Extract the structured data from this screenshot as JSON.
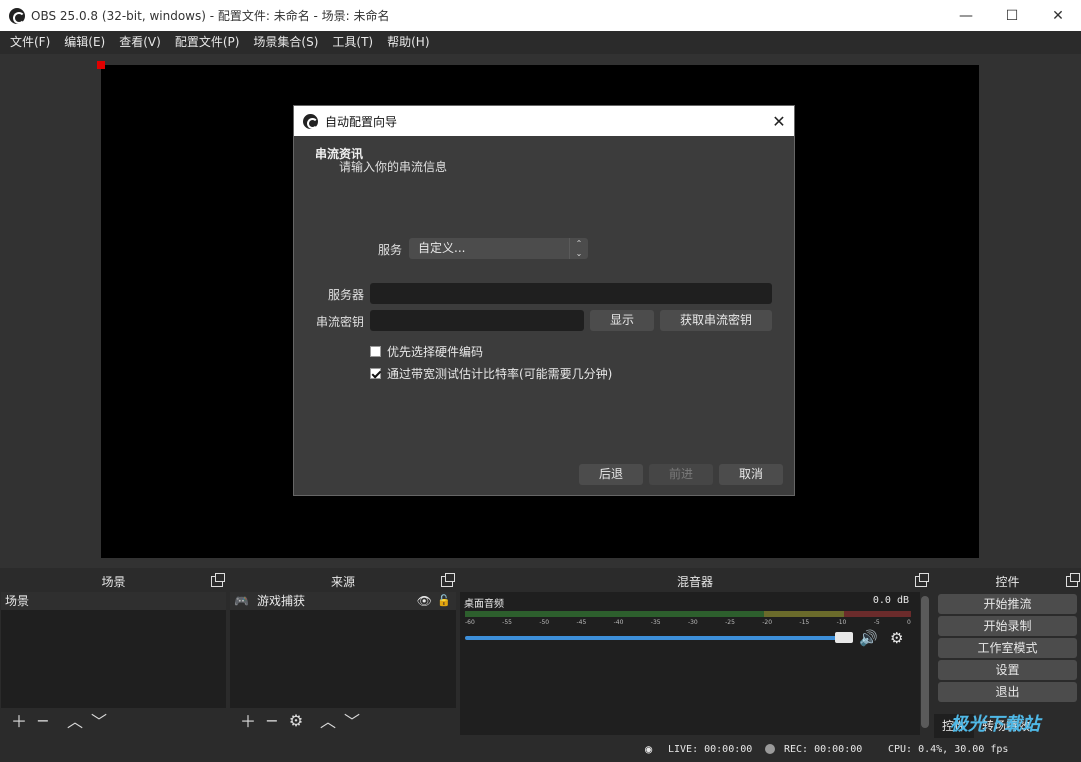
{
  "window": {
    "title": "OBS 25.0.8 (32-bit, windows) - 配置文件: 未命名 - 场景: 未命名",
    "minimize": "—",
    "maximize": "☐",
    "close": "✕"
  },
  "menu": [
    "文件(F)",
    "编辑(E)",
    "查看(V)",
    "配置文件(P)",
    "场景集合(S)",
    "工具(T)",
    "帮助(H)"
  ],
  "dialog": {
    "title": "自动配置向导",
    "close": "✕",
    "section_title": "串流资讯",
    "section_subtitle": "请输入你的串流信息",
    "service_label": "服务",
    "service_value": "自定义...",
    "server_label": "服务器",
    "server_value": "",
    "key_label": "串流密钥",
    "key_value": "",
    "show_button": "显示",
    "get_key_button": "获取串流密钥",
    "hw_encode_label": "优先选择硬件编码",
    "hw_encode_checked": false,
    "bandwidth_test_label": "通过带宽测试估计比特率(可能需要几分钟)",
    "bandwidth_test_checked": true,
    "back_button": "后退",
    "next_button": "前进",
    "cancel_button": "取消"
  },
  "docks": {
    "scenes": {
      "title": "场景",
      "items": [
        "场景"
      ]
    },
    "sources": {
      "title": "来源",
      "items": [
        "游戏捕获"
      ]
    },
    "mixer": {
      "title": "混音器",
      "channel_name": "桌面音频",
      "level_db": "0.0 dB",
      "ticks": [
        "-60",
        "-55",
        "-50",
        "-45",
        "-40",
        "-35",
        "-30",
        "-25",
        "-20",
        "-15",
        "-10",
        "-5",
        "0"
      ],
      "volume": 0.98
    },
    "controls": {
      "title": "控件",
      "buttons": [
        "开始推流",
        "开始录制",
        "工作室模式",
        "设置",
        "退出"
      ],
      "tabs": [
        "控件",
        "转场特效"
      ]
    }
  },
  "status": {
    "live": "LIVE: 00:00:00",
    "rec": "REC: 00:00:00",
    "cpu": "CPU: 0.4%, 30.00 fps"
  },
  "watermark": "极光下载站"
}
